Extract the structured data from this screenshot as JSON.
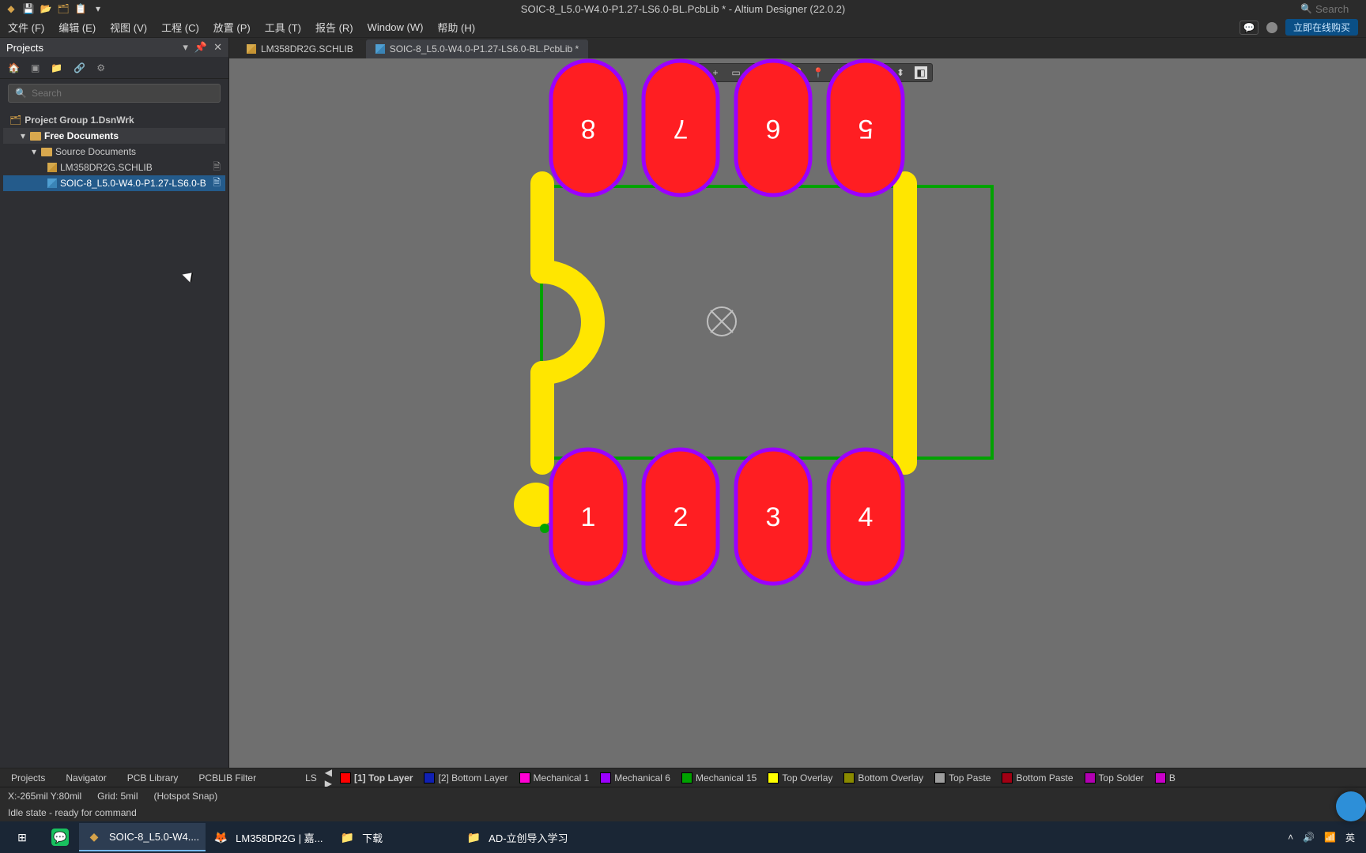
{
  "titlebar": {
    "title": "SOIC-8_L5.0-W4.0-P1.27-LS6.0-BL.PcbLib * - Altium Designer (22.0.2)",
    "search_placeholder": "Search"
  },
  "menubar": {
    "items": [
      {
        "label": "文件 (F)"
      },
      {
        "label": "编辑 (E)"
      },
      {
        "label": "视图 (V)"
      },
      {
        "label": "工程 (C)"
      },
      {
        "label": "放置 (P)"
      },
      {
        "label": "工具 (T)"
      },
      {
        "label": "报告 (R)"
      },
      {
        "label": "Window (W)"
      },
      {
        "label": "帮助 (H)"
      }
    ],
    "buy_online": "立即在线购买"
  },
  "projects_panel": {
    "title": "Projects",
    "search_placeholder": "Search",
    "root": "Project Group 1.DsnWrk",
    "free_docs": "Free Documents",
    "source_docs": "Source Documents",
    "doc1": "LM358DR2G.SCHLIB",
    "doc2": "SOIC-8_L5.0-W4.0-P1.27-LS6.0-B"
  },
  "tabs": {
    "tab1": "LM358DR2G.SCHLIB",
    "tab2": "SOIC-8_L5.0-W4.0-P1.27-LS6.0-BL.PcbLib *"
  },
  "midtabs": {
    "projects": "Projects",
    "navigator": "Navigator",
    "pcblib": "PCB Library",
    "pcblibfilter": "PCBLIB Filter"
  },
  "layer_strip": {
    "ls_label": "LS",
    "layers": [
      {
        "name": "[1] Top Layer",
        "color": "#ff0000",
        "bold": true
      },
      {
        "name": "[2] Bottom Layer",
        "color": "#1020b2"
      },
      {
        "name": "Mechanical 1",
        "color": "#ff00d4"
      },
      {
        "name": "Mechanical 6",
        "color": "#9b00ff"
      },
      {
        "name": "Mechanical 15",
        "color": "#00a200"
      },
      {
        "name": "Top Overlay",
        "color": "#ffff00"
      },
      {
        "name": "Bottom Overlay",
        "color": "#8a8a00"
      },
      {
        "name": "Top Paste",
        "color": "#9e9e9e"
      },
      {
        "name": "Bottom Paste",
        "color": "#a20014"
      },
      {
        "name": "Top Solder",
        "color": "#b200b2"
      },
      {
        "name": "B",
        "color": "#c800c8"
      }
    ]
  },
  "status": {
    "coord": "X:-265mil Y:80mil",
    "grid": "Grid: 5mil",
    "snap": "(Hotspot Snap)",
    "status_text": "Idle state - ready for command"
  },
  "taskbar": {
    "items": [
      {
        "label": "",
        "icon": "⊞",
        "active": false
      },
      {
        "label": "",
        "icon": "wc",
        "active": false
      },
      {
        "label": "SOIC-8_L5.0-W4....",
        "icon": "ad",
        "active": true
      },
      {
        "label": "LM358DR2G | 嘉...",
        "icon": "ff",
        "active": false
      },
      {
        "label": "下载",
        "icon": "fld",
        "active": false
      },
      {
        "label": "AD-立创导入学习",
        "icon": "fld",
        "active": false
      }
    ],
    "tray_lang": "英"
  },
  "footprint": {
    "pin_numbers_top": [
      "8",
      "7",
      "6",
      "5"
    ],
    "pin_numbers_bottom": [
      "1",
      "2",
      "3",
      "4"
    ]
  }
}
